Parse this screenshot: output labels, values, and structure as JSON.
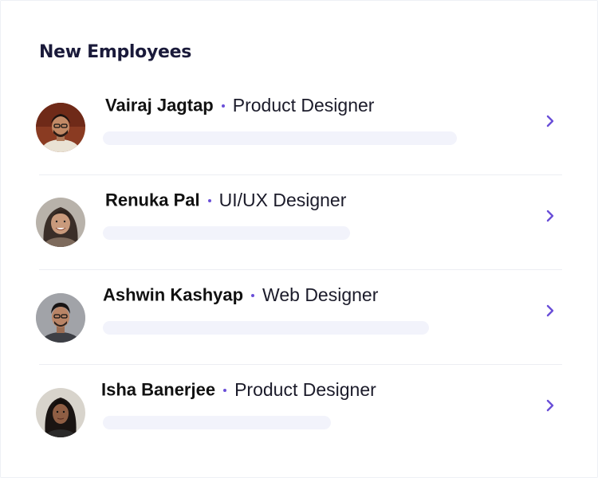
{
  "header": {
    "title": "New Employees"
  },
  "employees": [
    {
      "name": "Vairaj Jagtap",
      "role": "Product Designer",
      "progress": 0.76,
      "avatar_icon": "avatar-photo-icon"
    },
    {
      "name": "Renuka Pal",
      "role": "UI/UX Designer",
      "progress": 0.53,
      "avatar_icon": "avatar-photo-icon"
    },
    {
      "name": "Ashwin Kashyap",
      "role": "Web Designer",
      "progress": 0.7,
      "avatar_icon": "avatar-photo-icon"
    },
    {
      "name": "Isha Banerjee",
      "role": "Product Designer",
      "progress": 0.49,
      "avatar_icon": "avatar-photo-icon"
    }
  ],
  "colors": {
    "accent": "#6a4fd8",
    "bar": "#f2f3fb",
    "divider": "#eceef3",
    "title": "#1a1a3a"
  },
  "icons": {
    "chevron": "chevron-right-icon",
    "separator": "dot-separator-icon"
  }
}
